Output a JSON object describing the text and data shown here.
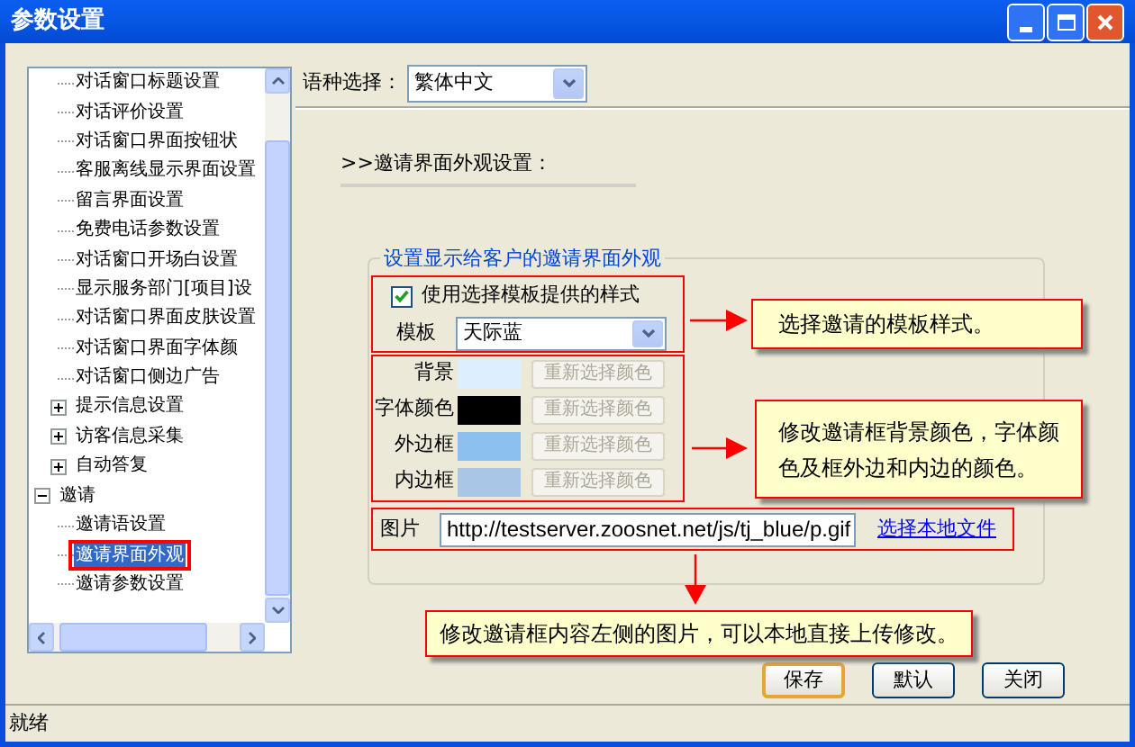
{
  "window": {
    "title": "参数设置"
  },
  "tree": {
    "partial_branch": [
      {
        "label": "对话窗口标题设置"
      },
      {
        "label": "对话评价设置"
      },
      {
        "label": "对话窗口界面按钮状"
      },
      {
        "label": "客服离线显示界面设置"
      },
      {
        "label": "留言界面设置"
      },
      {
        "label": "免费电话参数设置"
      },
      {
        "label": "对话窗口开场白设置"
      },
      {
        "label": "显示服务部门[项目]设"
      },
      {
        "label": "对话窗口界面皮肤设置"
      },
      {
        "label": "对话窗口界面字体颜"
      },
      {
        "label": "对话窗口侧边广告"
      },
      {
        "label": "提示信息设置",
        "expanded": false
      },
      {
        "label": "访客信息采集",
        "expanded": false
      },
      {
        "label": "自动答复",
        "expanded": false
      }
    ],
    "items": [
      {
        "label": "邀请",
        "expanded": true,
        "children": [
          {
            "label": "邀请语设置",
            "selected": false
          },
          {
            "label": "邀请界面外观",
            "selected": true
          },
          {
            "label": "邀请参数设置",
            "selected": false
          }
        ]
      }
    ]
  },
  "language": {
    "label": "语种选择：",
    "value": "繁体中文"
  },
  "section_title": ">>邀请界面外观设置：",
  "group": {
    "legend": "设置显示给客户的邀请界面外观",
    "use_template": {
      "label": "使用选择模板提供的样式",
      "checked": true
    },
    "template": {
      "label": "模板",
      "value": "天际蓝"
    },
    "colors": [
      {
        "label": "背景",
        "color": "#ddeefe",
        "button": "重新选择颜色",
        "disabled": true
      },
      {
        "label": "字体颜色",
        "color": "#000000",
        "button": "重新选择颜色",
        "disabled": true
      },
      {
        "label": "外边框",
        "color": "#8cc0ee",
        "button": "重新选择颜色",
        "disabled": true
      },
      {
        "label": "内边框",
        "color": "#a9c6e6",
        "button": "重新选择颜色",
        "disabled": true
      }
    ],
    "image": {
      "label": "图片",
      "value": "http://testserver.zoosnet.net/js/tj_blue/p.gif",
      "link": "选择本地文件"
    }
  },
  "callouts": [
    "选择邀请的模板样式。",
    "修改邀请框背景颜色，字体颜色及框外边和内边的颜色。",
    "修改邀请框内容左侧的图片，可以本地直接上传修改。"
  ],
  "buttons": [
    {
      "label": "保存",
      "default": true
    },
    {
      "label": "默认",
      "default": false
    },
    {
      "label": "关闭",
      "default": false
    }
  ],
  "status_bar": "就绪"
}
